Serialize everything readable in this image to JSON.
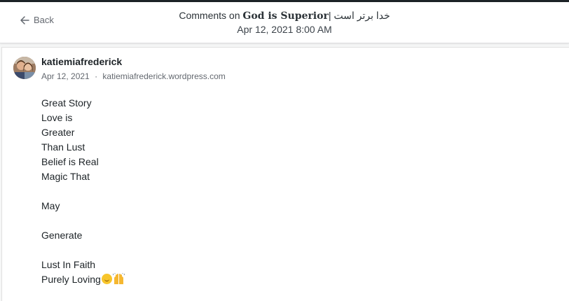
{
  "header": {
    "back_label": "Back",
    "title_prefix": "Comments on",
    "post_title": "God is Superior",
    "title_suffix": "| خدا برتر است",
    "date": "Apr 12, 2021 8:00 AM"
  },
  "comment": {
    "author": "katiemiafrederick",
    "date": "Apr 12, 2021",
    "separator": "·",
    "site": "katiemiafrederick.wordpress.com",
    "lines": [
      "Great Story",
      "Love is",
      "Greater",
      "Than Lust",
      "Belief is Real",
      "Magic That",
      "",
      "May",
      "",
      "Generate",
      "",
      "Lust In Faith",
      "Purely Loving"
    ],
    "emojis": [
      "smiling-face-emoji",
      "raising-hands-emoji"
    ]
  },
  "colors": {
    "page_background": "#f6f7f7",
    "header_background": "#ffffff",
    "text_primary": "#1d2327",
    "text_secondary": "#646970",
    "emoji_yellow": "#f7c52b"
  },
  "icons": {
    "back": "arrow-left-icon",
    "avatar": "avatar-photo"
  }
}
